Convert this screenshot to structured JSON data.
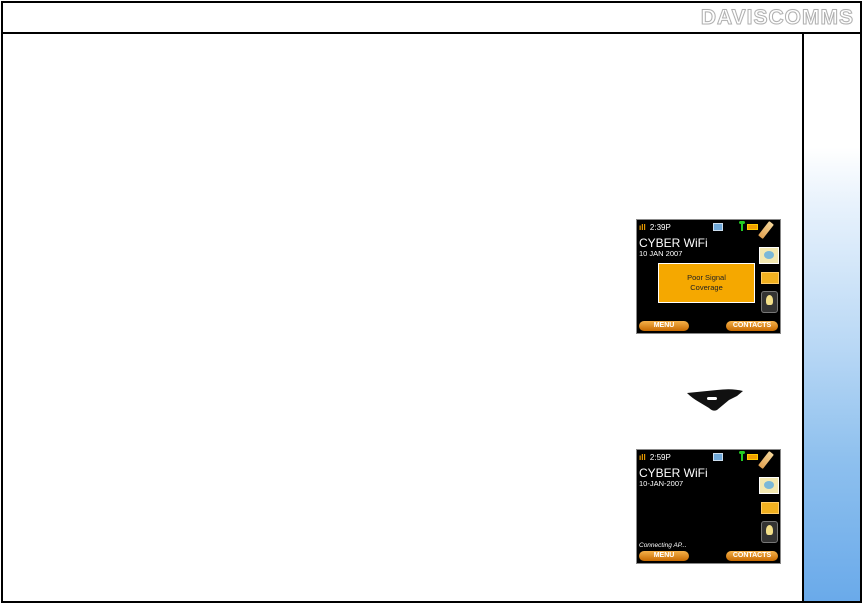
{
  "header": {
    "logo": "DAVISCOMMS"
  },
  "screen1": {
    "time": "2:39P",
    "title": "CYBER WiFi",
    "date": "10 JAN 2007",
    "popup_line1": "Poor Signal",
    "popup_line2": "Coverage",
    "left_softkey": "MENU",
    "right_softkey": "CONTACTS"
  },
  "screen2": {
    "time": "2:59P",
    "title": "CYBER WiFi",
    "date": "10-JAN-2007",
    "status_text": "Connecting AP...",
    "left_softkey": "MENU",
    "right_softkey": "CONTACTS"
  },
  "icons": [
    "signal-icon",
    "envelope-icon",
    "antenna-icon",
    "battery-icon",
    "pencil-icon",
    "softkey-icon"
  ],
  "colors": {
    "accent_orange": "#f5a800",
    "sidebar_blue": "#6aaaea"
  }
}
